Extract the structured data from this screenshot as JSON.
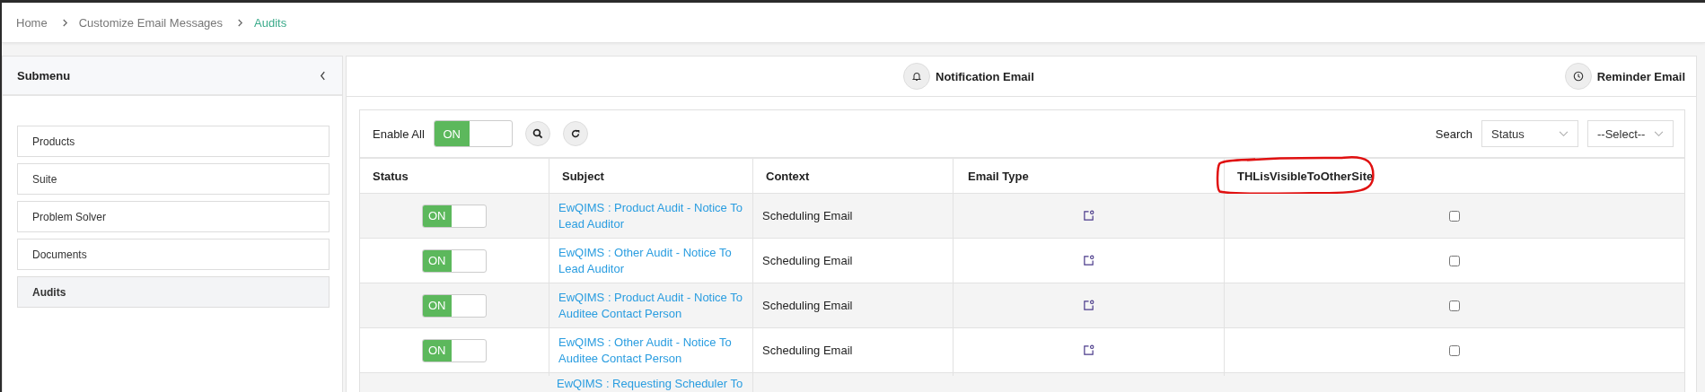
{
  "breadcrumb": [
    {
      "label": "Home",
      "current": false
    },
    {
      "label": "Customize Email Messages",
      "current": false
    },
    {
      "label": "Audits",
      "current": true
    }
  ],
  "sidebar": {
    "title": "Submenu",
    "items": [
      {
        "label": "Products",
        "selected": false
      },
      {
        "label": "Suite",
        "selected": false
      },
      {
        "label": "Problem Solver",
        "selected": false
      },
      {
        "label": "Documents",
        "selected": false
      },
      {
        "label": "Audits",
        "selected": true
      }
    ]
  },
  "email_tabs": [
    {
      "label": "Notification Email",
      "kind": "bell"
    },
    {
      "label": "Reminder Email",
      "kind": "clock"
    }
  ],
  "toolbar": {
    "enable_all_label": "Enable All",
    "enable_all": {
      "label": "ON",
      "on": true
    },
    "search_label": "Search",
    "filters": [
      {
        "value": "Status"
      },
      {
        "value": "--Select--"
      }
    ]
  },
  "table": {
    "columns": [
      "Status",
      "Subject",
      "Context",
      "Email Type",
      "THLisVisibleToOtherSite"
    ],
    "rows": [
      {
        "status": {
          "label": "ON",
          "on": true
        },
        "subject": "EwQIMS : Product Audit - Notice To Lead Auditor",
        "context": "Scheduling Email",
        "visible": false
      },
      {
        "status": {
          "label": "ON",
          "on": true
        },
        "subject": "EwQIMS : Other Audit - Notice To Lead Auditor",
        "context": "Scheduling Email",
        "visible": false
      },
      {
        "status": {
          "label": "ON",
          "on": true
        },
        "subject": "EwQIMS : Product Audit - Notice To Auditee Contact Person",
        "context": "Scheduling Email",
        "visible": false
      },
      {
        "status": {
          "label": "ON",
          "on": true
        },
        "subject": "EwQIMS : Other Audit - Notice To Auditee Contact Person",
        "context": "Scheduling Email",
        "visible": false
      },
      {
        "subject": "EwQIMS : Requesting Scheduler To"
      }
    ]
  }
}
